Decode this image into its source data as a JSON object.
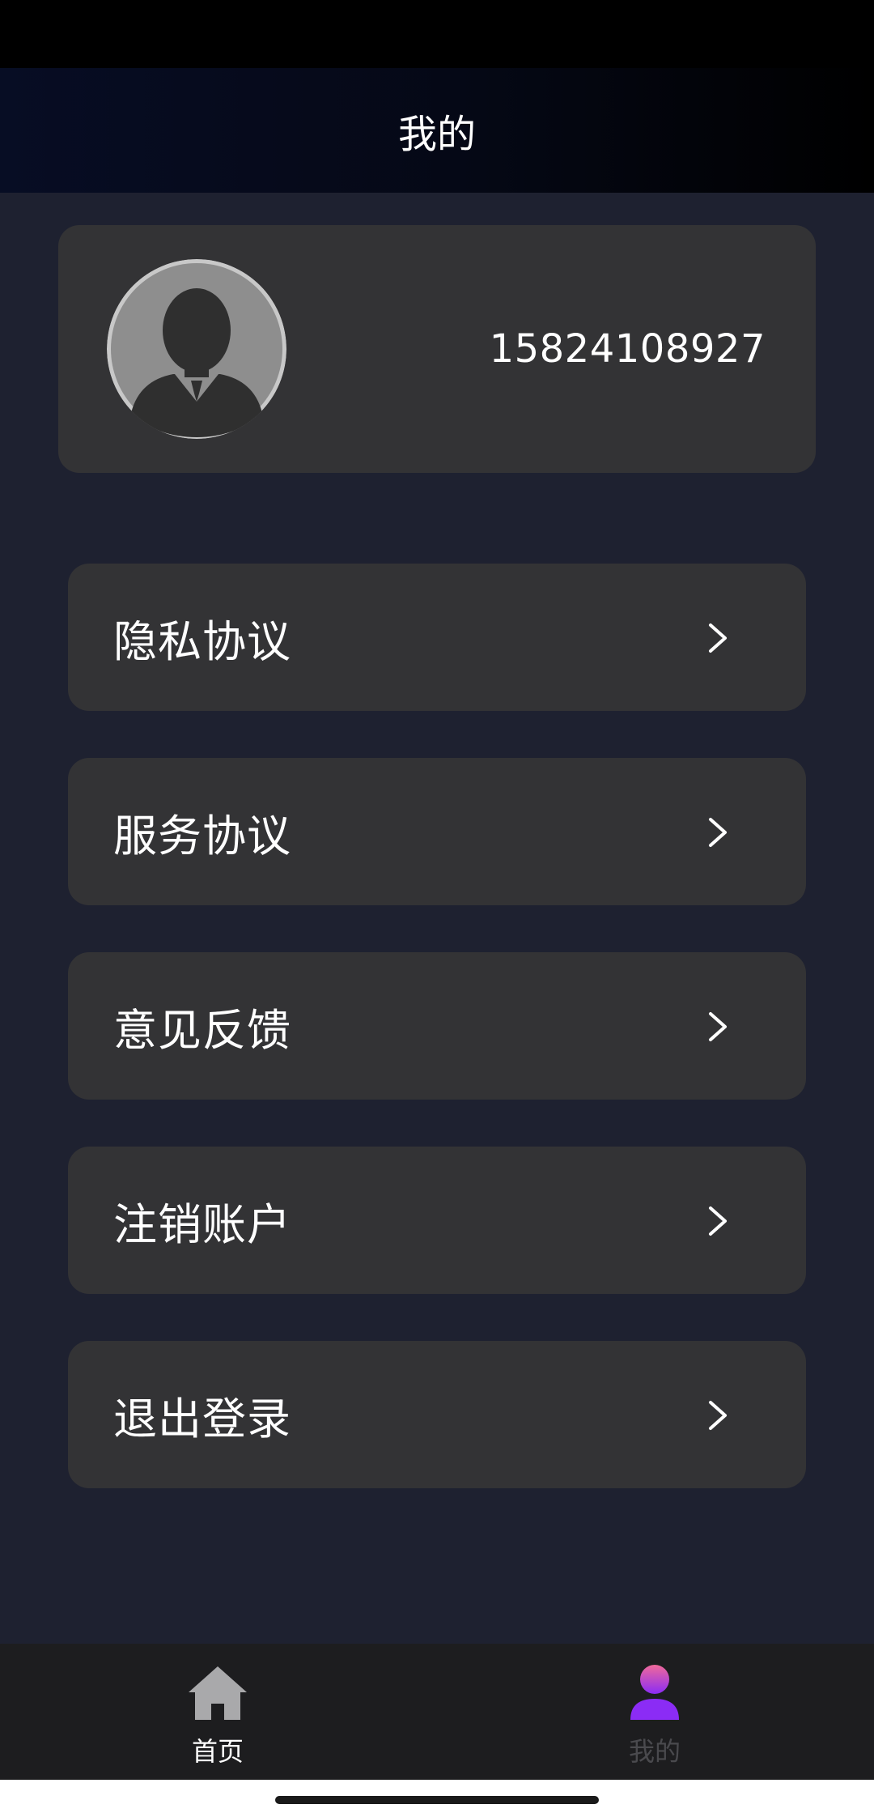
{
  "header": {
    "title": "我的"
  },
  "profile": {
    "avatar_icon": "default-user-avatar-icon",
    "phone": "15824108927"
  },
  "menu": {
    "items": [
      {
        "label": "隐私协议",
        "icon": "chevron-right-icon"
      },
      {
        "label": "服务协议",
        "icon": "chevron-right-icon"
      },
      {
        "label": "意见反馈",
        "icon": "chevron-right-icon"
      },
      {
        "label": "注销账户",
        "icon": "chevron-right-icon"
      },
      {
        "label": "退出登录",
        "icon": "chevron-right-icon"
      }
    ]
  },
  "tabbar": {
    "tabs": [
      {
        "label": "首页",
        "icon": "home-icon",
        "active": false
      },
      {
        "label": "我的",
        "icon": "user-icon",
        "active": true
      }
    ]
  },
  "colors": {
    "background": "#1e2130",
    "card": "#333335",
    "tabbar": "#1d1d1f",
    "active_icon_top": "#f06a9a",
    "active_icon_bottom": "#8b2cf5"
  }
}
